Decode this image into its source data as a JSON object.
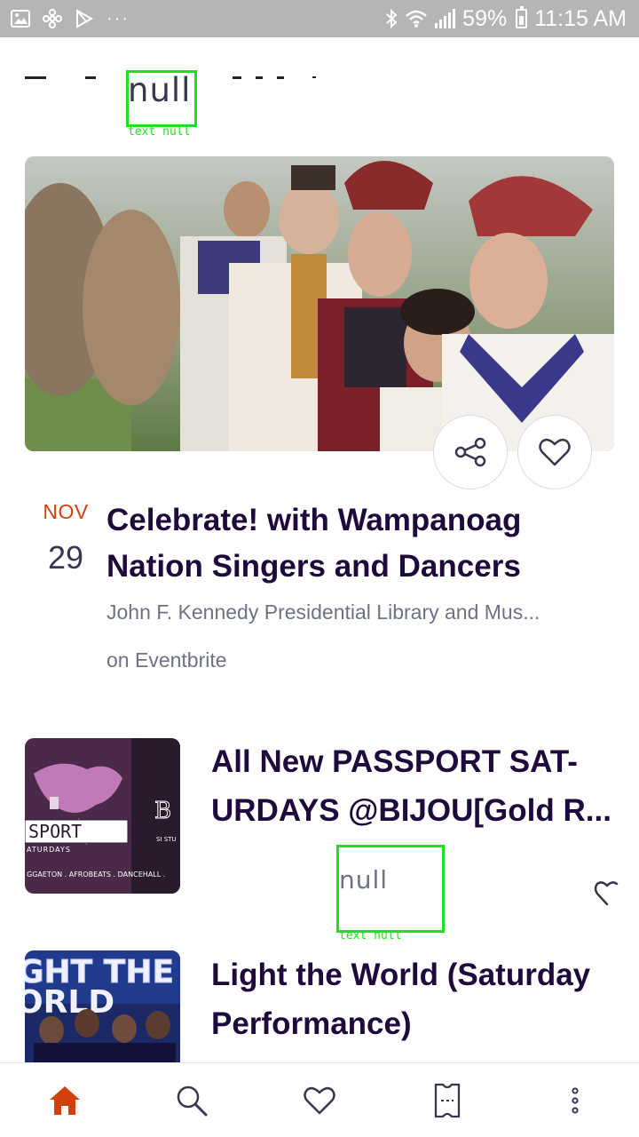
{
  "status_bar": {
    "notification_icons": [
      "gallery-icon",
      "pinwheel-icon",
      "play-store-icon"
    ],
    "overflow": "···",
    "battery": "59%",
    "time": "11:15 AM"
  },
  "header": {
    "debug_text": "null",
    "debug_label": "text null"
  },
  "featured_event": {
    "month": "NOV",
    "day": "29",
    "title": "Celebrate! with Wampanoag Nation Singers and Dancers",
    "venue": "John F. Kennedy Presidential Library and Mus...",
    "source": "on Eventbrite"
  },
  "list_events": [
    {
      "title": "All New PASSPORT SAT-URDAYS @BIJOU[Gold R...",
      "thumb_text": {
        "brand": "SPORT",
        "sub": "ATURDAYS",
        "genres": "GGAETON . AFROBEATS . DANCEHALL .",
        "venue_initial": "B",
        "venue_sub": "SI STU"
      },
      "debug_text": "null",
      "debug_label": "text null"
    },
    {
      "title": "Light the World (Saturday Performance)",
      "thumb_text": {
        "line1": "GHT THE",
        "line2": "ORLD"
      }
    }
  ],
  "colors": {
    "accent": "#d1410c",
    "title": "#1e0a3c",
    "secondary_text": "#6f7287",
    "debug_box": "#22dd22",
    "status_bar": "#b5b5b5"
  },
  "bottom_nav": [
    "home-icon",
    "search-icon",
    "heart-icon",
    "ticket-icon",
    "more-icon"
  ]
}
